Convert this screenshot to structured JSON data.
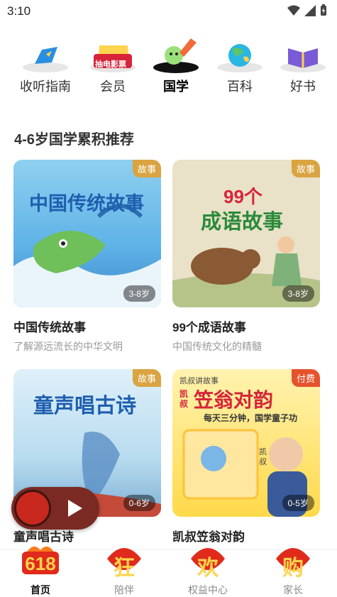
{
  "status": {
    "time": "3:10"
  },
  "categories": [
    {
      "label": "收听指南",
      "icon": "compass-icon"
    },
    {
      "label": "会员",
      "icon": "vip-ticket-icon",
      "badge": "抽电影票"
    },
    {
      "label": "国学",
      "icon": "brush-icon",
      "active": true
    },
    {
      "label": "百科",
      "icon": "globe-icon"
    },
    {
      "label": "好书",
      "icon": "book-icon"
    }
  ],
  "section": {
    "title": "4-6岁国学累积推荐"
  },
  "cards": [
    {
      "title": "中国传统故事",
      "subtitle": "了解源远流长的中华文明",
      "tag": "故事",
      "age": "3-8岁",
      "cover_text": "中国传统故事"
    },
    {
      "title": "99个成语故事",
      "subtitle": "中国传统文化的精髓",
      "tag": "故事",
      "age": "3-8岁",
      "cover_text_top": "99个",
      "cover_text_bottom": "成语故事"
    },
    {
      "title": "童声唱古诗",
      "subtitle": "",
      "tag": "故事",
      "age": "0-6岁",
      "cover_text": "童声唱古诗"
    },
    {
      "title": "凯叔笠翁对韵",
      "subtitle": "",
      "tag": "付费",
      "age": "0-5岁",
      "cover_brand": "凯叔讲故事",
      "cover_side": "凯叔",
      "cover_text": "笠翁对韵",
      "cover_slogan": "每天三分钟，国学童子功",
      "cover_small": "凯叔"
    }
  ],
  "tabs": [
    {
      "label": "首页",
      "badge": "618",
      "active": true
    },
    {
      "label": "陪伴",
      "badge": "狂"
    },
    {
      "label": "权益中心",
      "badge": "欢"
    },
    {
      "label": "家长",
      "badge": "购"
    }
  ],
  "colors": {
    "tag_story": "#d9a441",
    "tag_paid": "#e5532d",
    "festival_red": "#e02a1c",
    "festival_gold": "#ffd34d"
  }
}
